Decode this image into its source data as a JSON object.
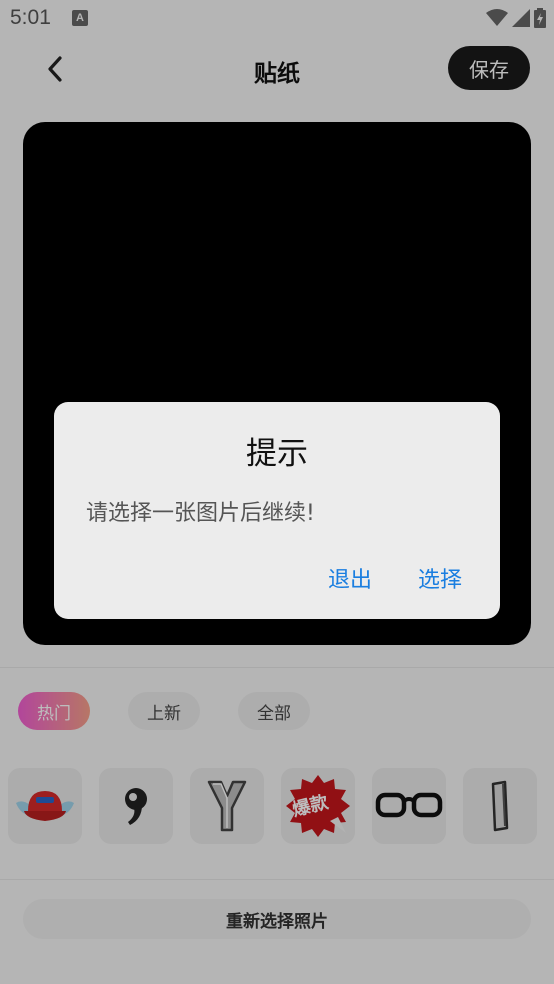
{
  "status_bar": {
    "time": "5:01",
    "notification_glyph": "A"
  },
  "header": {
    "title": "贴纸",
    "save_label": "保存"
  },
  "tabs": [
    {
      "label": "热门",
      "active": true
    },
    {
      "label": "上新",
      "active": false
    },
    {
      "label": "全部",
      "active": false
    }
  ],
  "stickers": [
    {
      "name": "winged-cap",
      "label": ""
    },
    {
      "name": "comma-mark",
      "label": ""
    },
    {
      "name": "letter-y",
      "label": ""
    },
    {
      "name": "hot-badge",
      "label": "爆款"
    },
    {
      "name": "glasses",
      "label": ""
    },
    {
      "name": "letter-i",
      "label": ""
    }
  ],
  "reselect_label": "重新选择照片",
  "dialog": {
    "title": "提示",
    "message": "请选择一张图片后继续!",
    "cancel_label": "退出",
    "confirm_label": "选择"
  },
  "colors": {
    "accent": "#1a7ee0",
    "save_bg": "#1a1a1a",
    "tab_gradient_start": "#f15fd1",
    "tab_gradient_end": "#f7a08a"
  }
}
